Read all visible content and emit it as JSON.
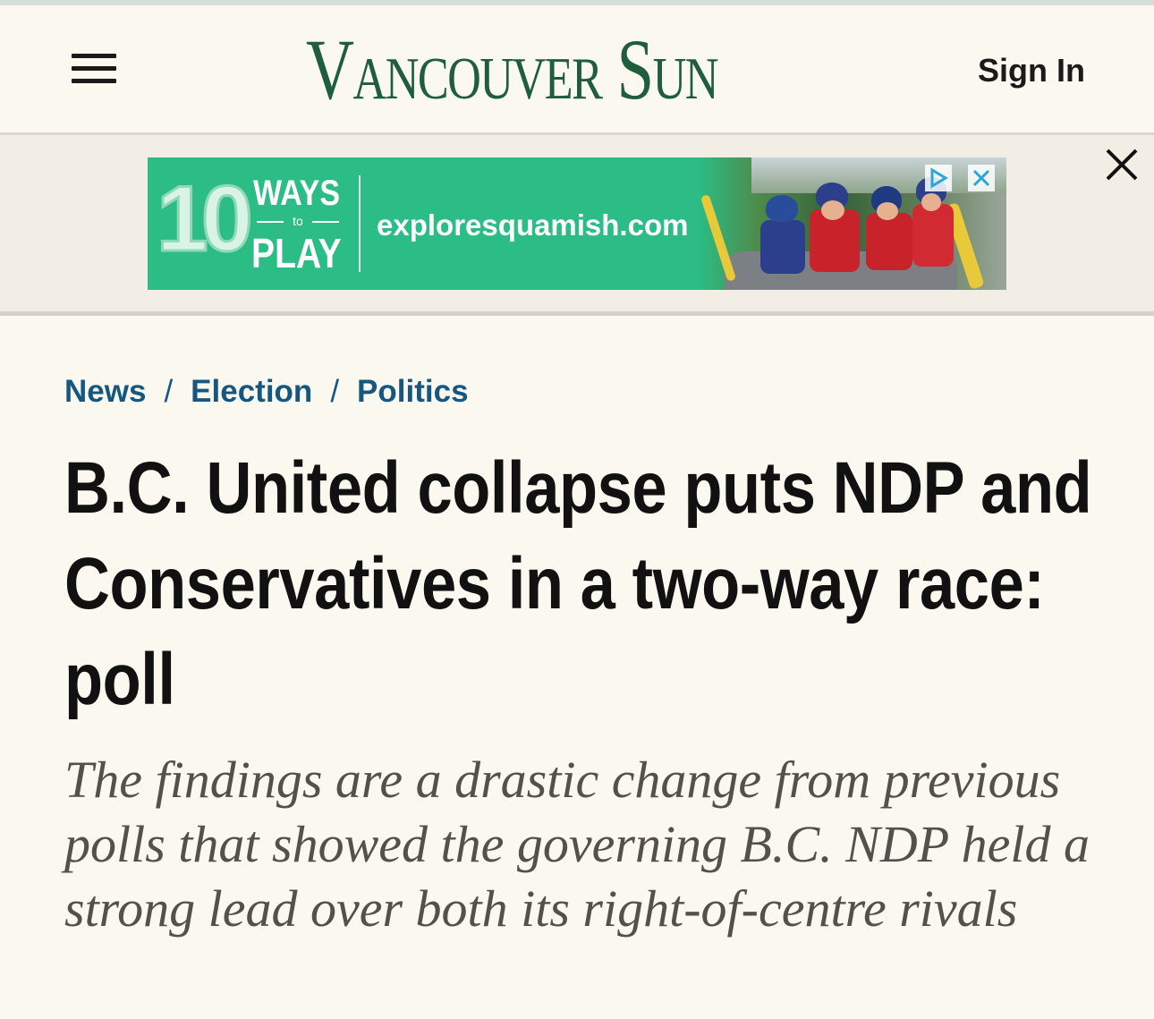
{
  "header": {
    "logo_text": "Vancouver Sun",
    "sign_in_label": "Sign In"
  },
  "ad": {
    "ten": "10",
    "ways": "WAYS",
    "to": "to",
    "play": "PLAY",
    "url": "exploresquamish.com",
    "colors": {
      "background": "#2bbd85"
    }
  },
  "breadcrumb": {
    "items": [
      "News",
      "Election",
      "Politics"
    ],
    "separator": "/"
  },
  "article": {
    "headline": "B.C. United collapse puts NDP and Conservatives in a two-way race: poll",
    "deck": "The findings are a drastic change from previous polls that showed the governing B.C. NDP held a strong lead over both its right-of-centre rivals"
  },
  "colors": {
    "page_background": "#fbf8f0",
    "logo_green": "#1f5e3c",
    "link_blue": "#15577e",
    "headline": "#111111",
    "deck": "#555049"
  }
}
